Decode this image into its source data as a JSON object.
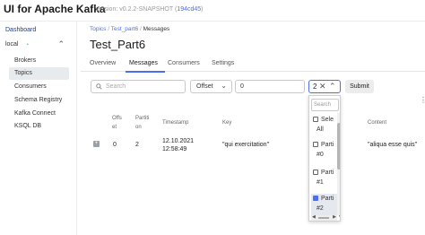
{
  "app": {
    "title": "UI for Apache Kafka",
    "version_prefix": "Version: v0.2.2-SNAPSHOT (",
    "version_hash": "194cd45",
    "version_suffix": ")"
  },
  "sidebar": {
    "dashboard": "Dashboard",
    "cluster": {
      "name": "local",
      "status_dot": "•",
      "chevron": "⌃"
    },
    "items": [
      {
        "label": "Brokers",
        "active": false
      },
      {
        "label": "Topics",
        "active": true
      },
      {
        "label": "Consumers",
        "active": false
      },
      {
        "label": "Schema Registry",
        "active": false
      },
      {
        "label": "Kafka Connect",
        "active": false
      },
      {
        "label": "KSQL DB",
        "active": false
      }
    ]
  },
  "breadcrumb": {
    "topics": "Topics",
    "sep1": "/",
    "topic": "Test_part6",
    "sep2": "/",
    "current": "Messages"
  },
  "page_title": "Test_Part6",
  "tabs": [
    "Overview",
    "Messages",
    "Consumers",
    "Settings"
  ],
  "active_tab": "Messages",
  "filters": {
    "search_placeholder": "Search",
    "offset_select": "Offset",
    "offset_value": "0",
    "partition_value": "2",
    "submit_label": "Submit"
  },
  "table": {
    "headers": {
      "offset_1": "Offs",
      "offset_2": "et",
      "partition_1": "Partiti",
      "partition_2": "on",
      "timestamp": "Timestamp",
      "key": "Key",
      "content": "Content"
    },
    "rows": [
      {
        "offset": "0",
        "partition": "2",
        "timestamp_date": "12.10.2021",
        "timestamp_time": "12:58:49",
        "key": "\"qui exercitation\"",
        "content": "\"aliqua esse quis\""
      }
    ]
  },
  "dropdown": {
    "search_placeholder": "Search",
    "options": [
      {
        "line1": "Sele",
        "line2": "All",
        "checked": false
      },
      {
        "line1": "Parti",
        "line2": "#0",
        "checked": false
      },
      {
        "line1": "Parti",
        "line2": "#1",
        "checked": false
      },
      {
        "line1": "Parti",
        "line2": "#2",
        "checked": true
      }
    ]
  },
  "icons": {
    "search": "⌕",
    "clear": "✕",
    "chevron_down": "⌄",
    "chevron_up": "⌃",
    "expand": "+",
    "more": "⋮"
  },
  "colors": {
    "accent": "#4c6ef5",
    "active_nav_bg": "#e8ebee",
    "status_online": "#22c55e"
  }
}
